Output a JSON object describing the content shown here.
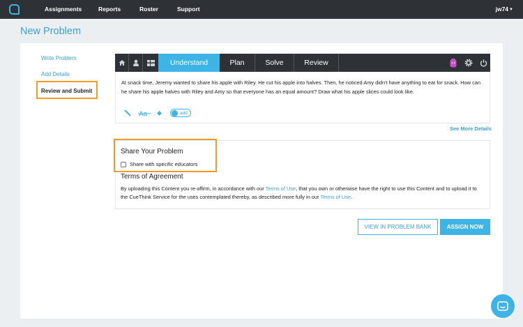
{
  "nav": {
    "items": [
      "Assignments",
      "Reports",
      "Roster",
      "Support"
    ],
    "user": "jw74"
  },
  "page_title": "New Problem",
  "steps": [
    "Write Problem",
    "Add Details",
    "Review and Submit"
  ],
  "toolbar": {
    "tabs": [
      "Understand",
      "Plan",
      "Solve",
      "Review"
    ],
    "active_tab": "Understand"
  },
  "problem": {
    "text": "At snack time, Jeremy wanted to share his apple with Riley. He cut his apple into halves. Then, he noticed Amy didn't have anything to eat for snack. How can he share his apple halves with Riley and Amy so that everyone has an equal amount? Draw what his apple slices could look like.",
    "add_label": "add"
  },
  "see_more": "See More Details",
  "share": {
    "title": "Share Your Problem",
    "checkbox_label": "Share with specific educators",
    "checked": false
  },
  "terms": {
    "title": "Terms of Agreement",
    "part1": "By uploading this Content you re-affirm, in accordance with our ",
    "link1": "Terms of Use",
    "part2": ", that you own or otherwise have the right to use this Content and to upload it to the CueThink Service for the uses contemplated thereby, as described more fully in our ",
    "link2": "Terms of Use",
    "part3": "."
  },
  "buttons": {
    "view_bank": "VIEW IN PROBLEM BANK",
    "assign": "ASSIGN NOW"
  },
  "colors": {
    "accent": "#3eb3e6",
    "nav_bg": "#2e3136",
    "highlight": "#f39c24",
    "badge": "#c94fc9"
  }
}
